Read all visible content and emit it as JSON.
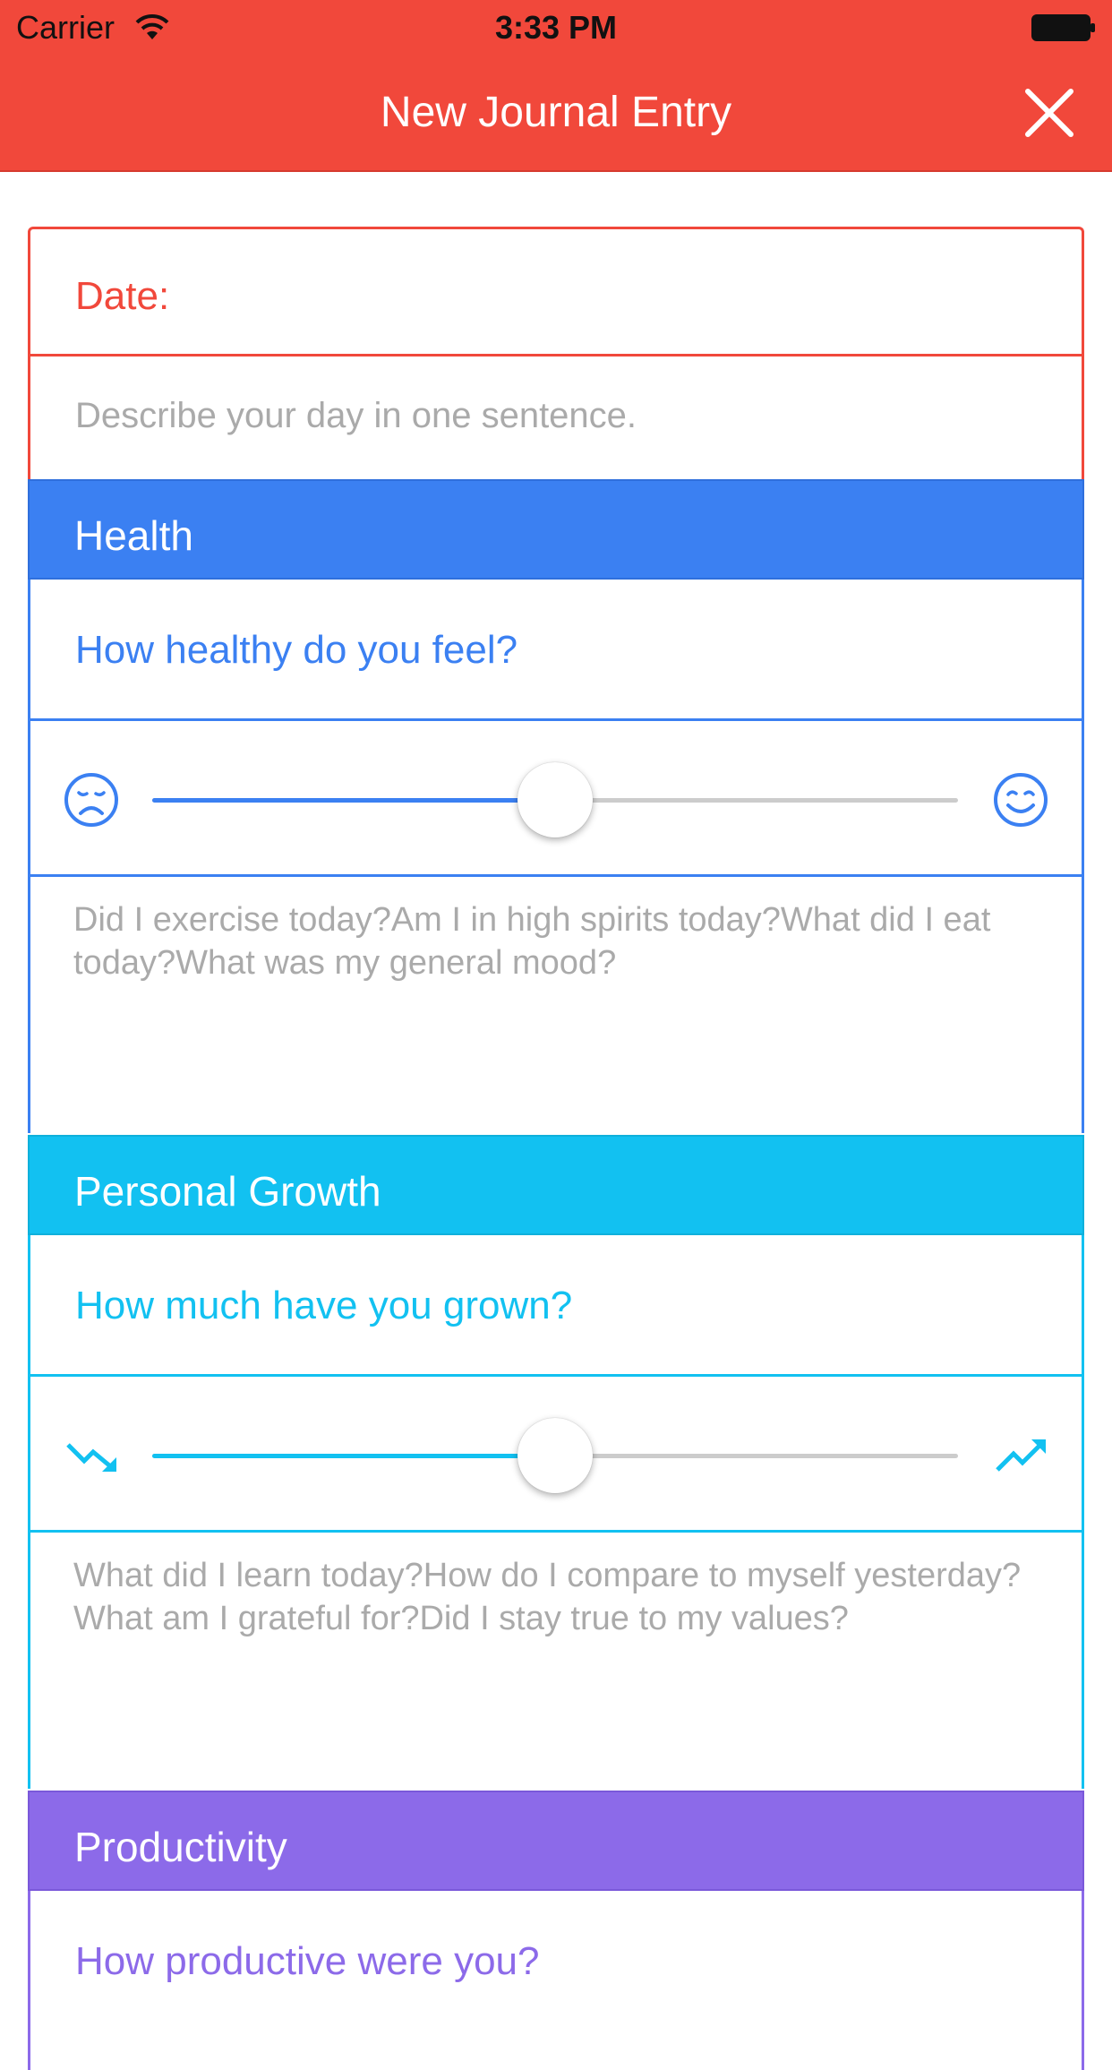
{
  "status_bar": {
    "carrier": "Carrier",
    "time": "3:33 PM",
    "wifi_icon": "wifi-icon",
    "battery_icon": "battery-icon"
  },
  "nav": {
    "title": "New Journal Entry",
    "close_icon": "close-icon"
  },
  "entry": {
    "date_label": "Date:",
    "description_placeholder": "Describe your day in one sentence.",
    "description_value": ""
  },
  "sections": {
    "health": {
      "title": "Health",
      "question": "How healthy do you feel?",
      "slider_value": 0.5,
      "left_icon": "sad-face-icon",
      "right_icon": "happy-face-icon",
      "notes_placeholder": "Did I exercise today?Am I in high spirits today?What did I eat today?What was my general mood?",
      "color": "#3b80f2"
    },
    "growth": {
      "title": "Personal Growth",
      "question": "How much have you grown?",
      "slider_value": 0.5,
      "left_icon": "trend-down-icon",
      "right_icon": "trend-up-icon",
      "notes_placeholder": "What did I learn today?How do I compare to myself yesterday?What am I grateful for?Did I stay true to my values?",
      "color": "#12c1f1"
    },
    "productivity": {
      "title": "Productivity",
      "question": "How productive were you?",
      "color": "#8c6ae9"
    }
  },
  "colors": {
    "accent": "#f1483b"
  }
}
